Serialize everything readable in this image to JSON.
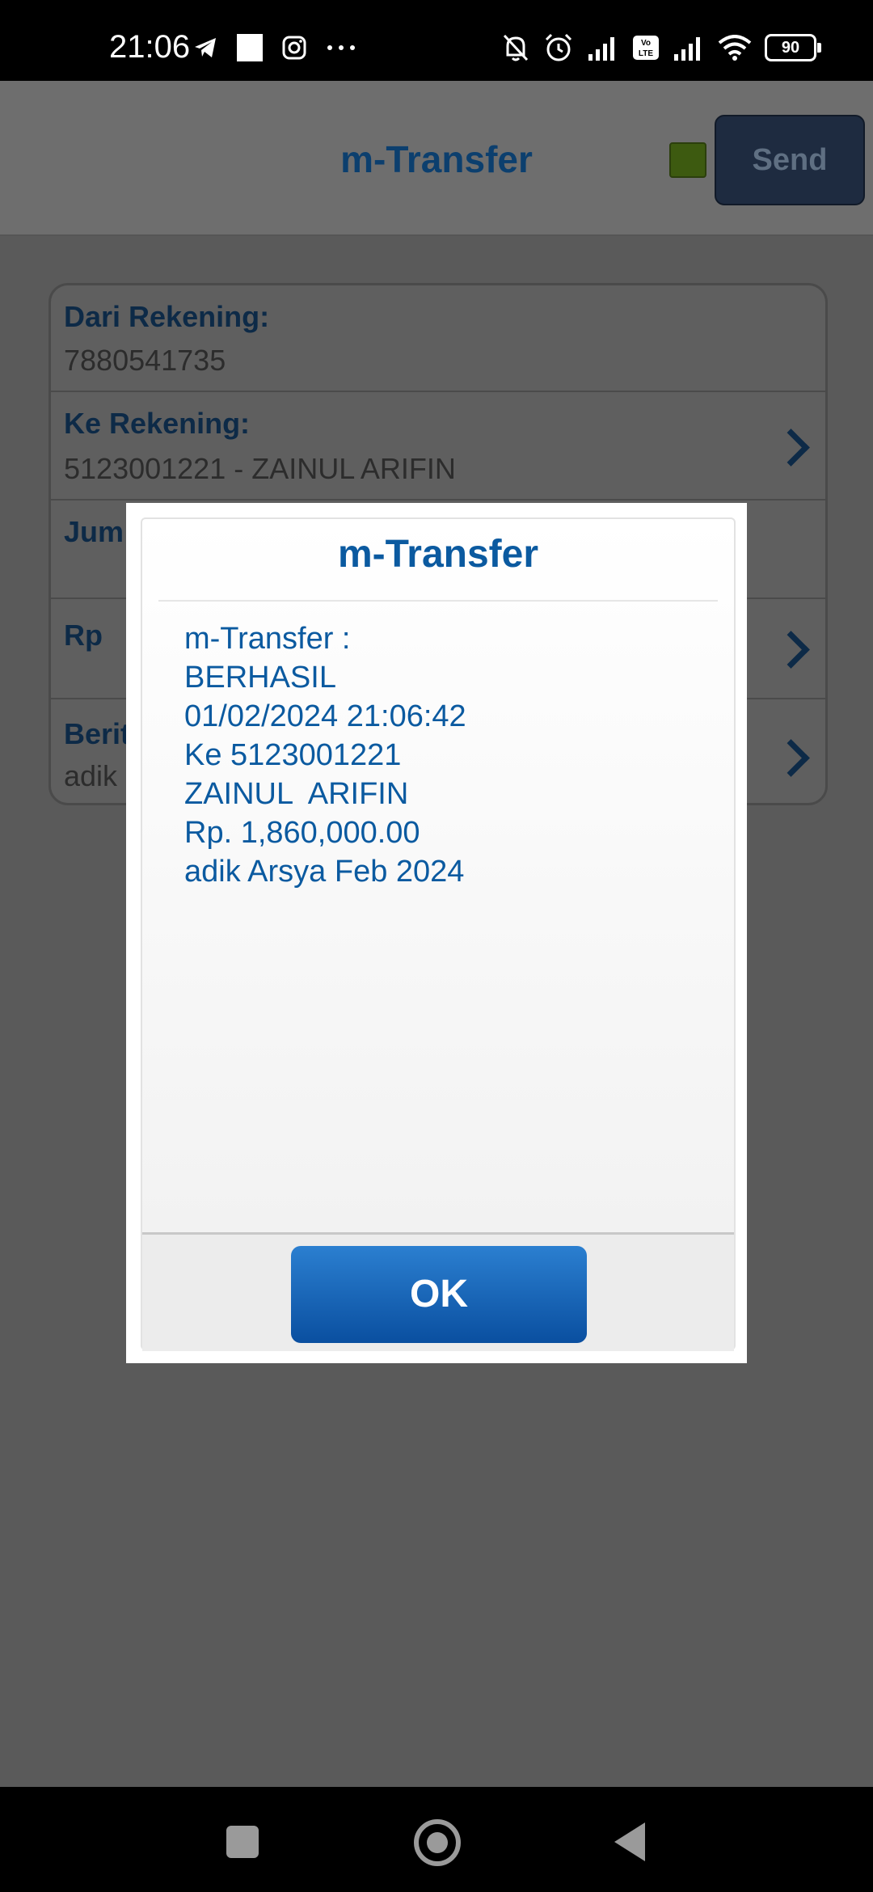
{
  "status_bar": {
    "time": "21:06",
    "left_icons": [
      "telegram-icon",
      "notification-icon",
      "instagram-icon",
      "more-icon"
    ],
    "right_icons": [
      "bell-off-icon",
      "alarm-icon",
      "signal-icon",
      "volte-icon",
      "signal-icon",
      "wifi-icon"
    ],
    "battery": "90"
  },
  "header": {
    "title": "m-Transfer",
    "send_label": "Send",
    "indicator_color": "#3d5a10"
  },
  "form": {
    "rows": [
      {
        "label": "Dari Rekening:",
        "value": "7880541735"
      },
      {
        "label": "Ke Rekening:",
        "value": "5123001221 - ZAINUL  ARIFIN"
      },
      {
        "label": "Jum",
        "value": ""
      },
      {
        "label": "Rp",
        "value": ""
      },
      {
        "label": "Berit",
        "value": "adik"
      }
    ]
  },
  "dialog": {
    "title": "m-Transfer",
    "lines": [
      "m-Transfer :",
      "BERHASIL",
      "01/02/2024 21:06:42",
      "Ke 5123001221",
      "ZAINUL  ARIFIN",
      "Rp. 1,860,000.00",
      "adik Arsya Feb 2024"
    ],
    "ok_label": "OK"
  },
  "nav_bar": {
    "buttons": [
      "recents-icon",
      "home-icon",
      "back-icon"
    ]
  }
}
